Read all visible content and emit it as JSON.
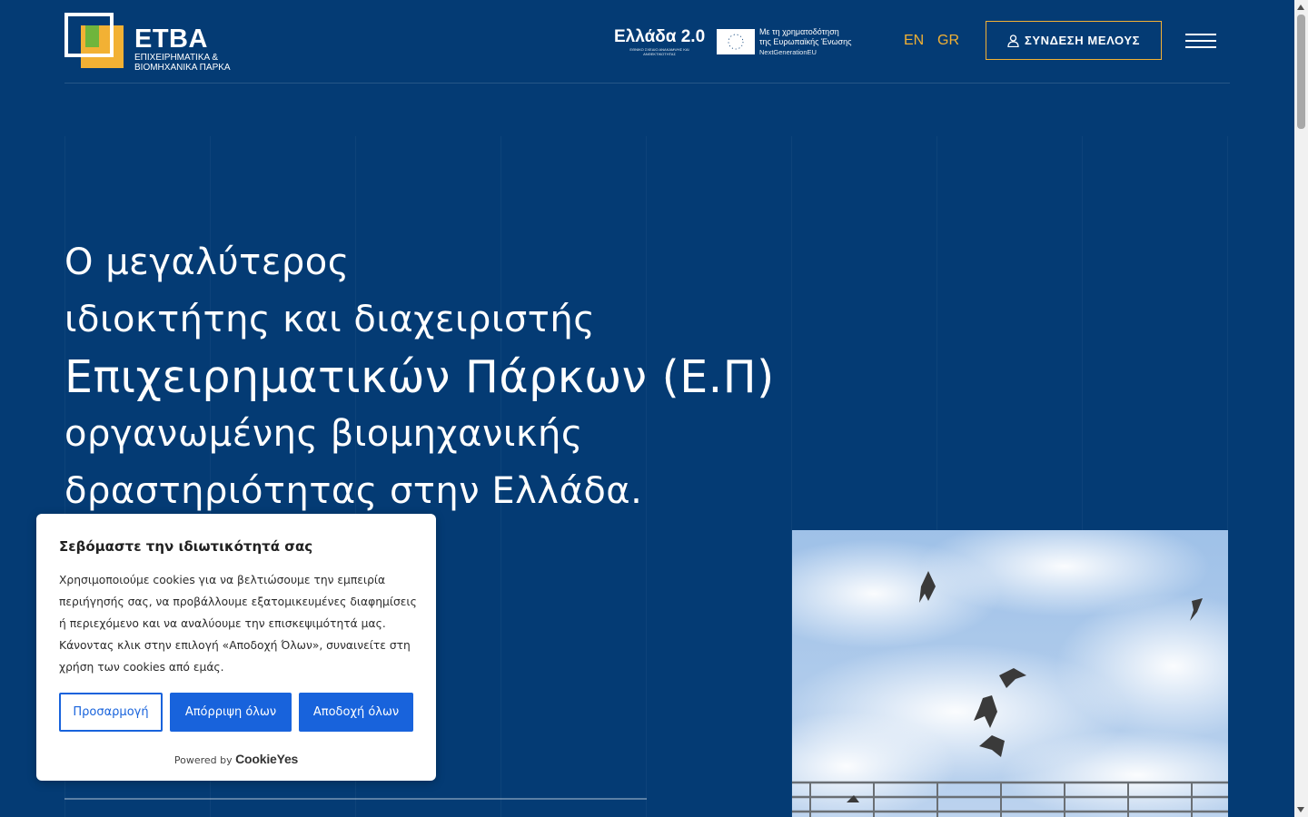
{
  "header": {
    "logo": {
      "name": "ΕΤΒΑ",
      "subtitle": "ΕΠΙΧΕΙΡΗΜΑΤΙΚΑ &\nΒΙΟΜΗΧΑΝΙΚΑ ΠΑΡΚΑ"
    },
    "greece20": {
      "title": "Ελλάδα 2.0",
      "subtitle": "ΕΘΝΙΚΟ ΣΧΕΔΙΟ ΑΝΑΚΑΜΨΗΣ ΚΑΙ ΑΝΘΕΚΤΙΚΟΤΗΤΑΣ"
    },
    "eu": {
      "line1": "Με τη χρηματοδότηση",
      "line2": "της Ευρωπαϊκής Ένωσης",
      "line3": "NextGenerationEU"
    },
    "languages": [
      "EN",
      "GR"
    ],
    "login_label": "ΣΥΝΔΕΣΗ ΜΕΛΟΥΣ"
  },
  "hero": {
    "lines": [
      "Ο μεγαλύτερος",
      "ιδιοκτήτης και διαχειριστής",
      "Επιχειρηματικών Πάρκων (Ε.Π)",
      "οργανωμένης βιομηχανικής",
      "δραστηριότητας στην Ελλάδα."
    ]
  },
  "cookie": {
    "title": "Σεβόμαστε την ιδιωτικότητά σας",
    "description": "Χρησιμοποιούμε cookies για να βελτιώσουμε την εμπειρία περιήγησής σας, να προβάλλουμε εξατομικευμένες διαφημίσεις ή περιεχόμενο και να αναλύουμε την επισκεψιμότητά μας. Κάνοντας κλικ στην επιλογή «Αποδοχή Όλων», συναινείτε στη χρήση των cookies από εμάς.",
    "customize_label": "Προσαρμογή",
    "reject_label": "Απόρριψη όλων",
    "accept_label": "Αποδοχή όλων",
    "powered_by": "Powered by",
    "brand": "CookieYes"
  },
  "colors": {
    "background": "#043b74",
    "accent": "#f2b134",
    "logo_green": "#6fb53c",
    "button_blue": "#1863dc"
  }
}
